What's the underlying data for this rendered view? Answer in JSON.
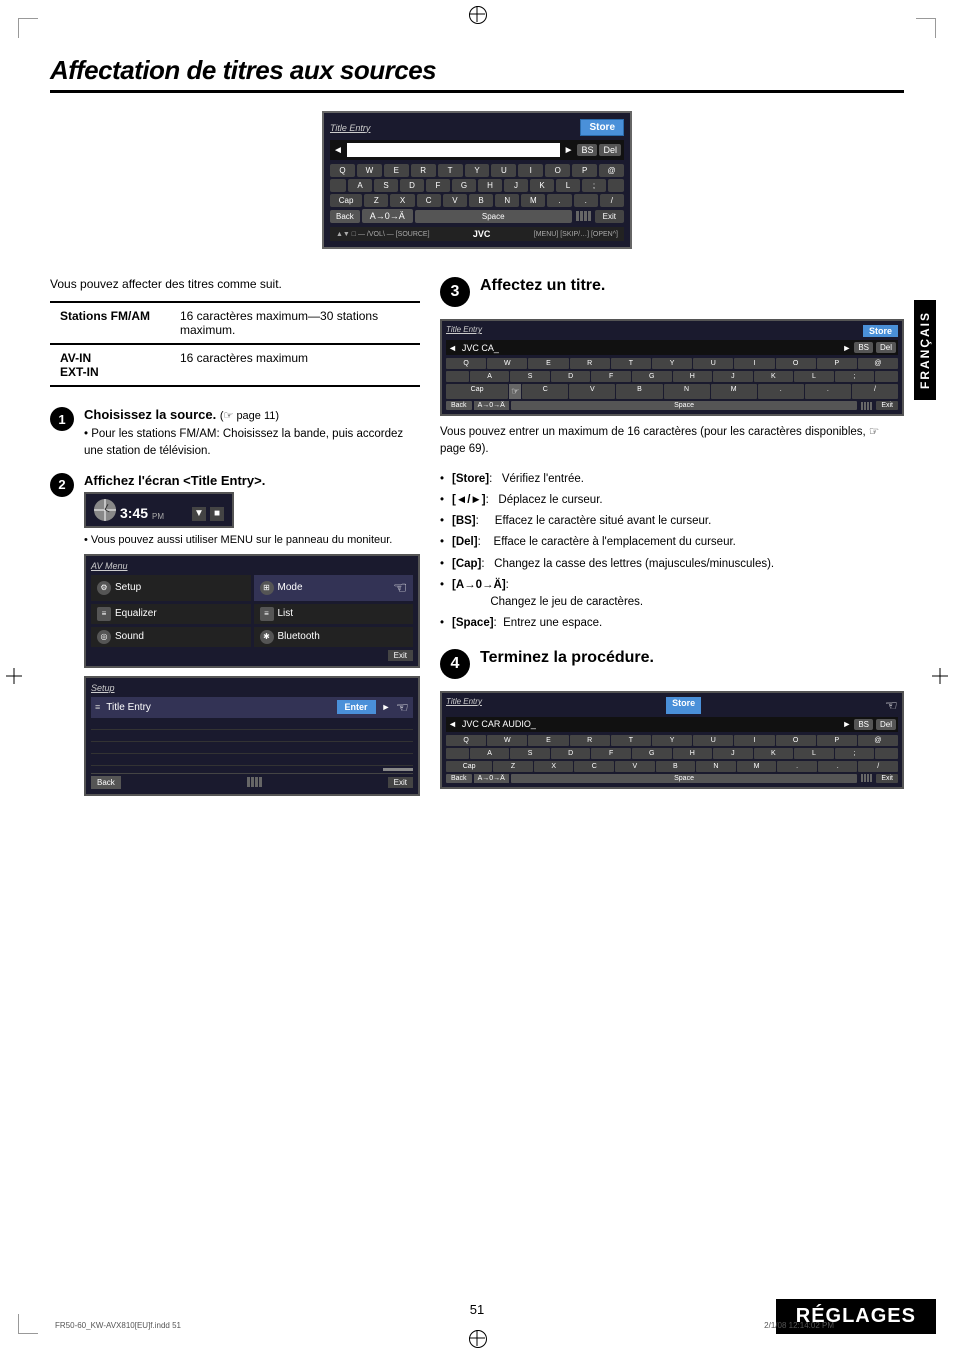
{
  "page": {
    "title": "Affectation de titres aux sources",
    "number": "51",
    "section": "RÉGLAGES",
    "language_tag": "FRANÇAIS",
    "file_info": "FR50-60_KW-AVX810[EU]f.indd   51",
    "date_info": "2/1/08   12:14:02 PM"
  },
  "intro_text": "Vous pouvez affecter des titres comme suit.",
  "table": {
    "rows": [
      {
        "header": "Stations FM/AM",
        "value": "16 caractères maximum—30 stations maximum."
      },
      {
        "header": "AV-IN\nEXT-IN",
        "value": "16 caractères maximum"
      }
    ]
  },
  "steps": [
    {
      "num": "1",
      "title": "Choisissez la source.",
      "ref": "(☞ page 11)",
      "body": "• Pour les stations FM/AM: Choisissez la bande, puis accordez une station de télévision."
    },
    {
      "num": "2",
      "title": "Affichez l'écran <Title Entry>.",
      "note": "• Vous pouvez aussi utiliser MENU sur le panneau du moniteur."
    },
    {
      "num": "3",
      "title": "Affectez un titre.",
      "body_text": "Vous pouvez entrer un maximum de 16 caractères (pour les caractères disponibles, ☞ page 69)."
    },
    {
      "num": "4",
      "title": "Terminez la procédure."
    }
  ],
  "bullet_items": [
    {
      "key": "[Store]",
      "desc": "Vérifiez l'entrée."
    },
    {
      "key": "[◄/►]",
      "desc": "Déplacez le curseur."
    },
    {
      "key": "[BS]",
      "desc": "Effacez le caractère situé avant le curseur."
    },
    {
      "key": "[Del]",
      "desc": "Efface le caractère à l'emplacement du curseur."
    },
    {
      "key": "[Cap]",
      "desc": "Changez la casse des lettres (majuscules/minuscules)."
    },
    {
      "key": "[A→0→Ä]",
      "desc": "Changez le jeu de caractères."
    },
    {
      "key": "[Space]",
      "desc": "Entrez une espace."
    }
  ],
  "title_entry_ui": {
    "title_label": "Title Entry",
    "store_label": "Store",
    "bs_label": "BS",
    "del_label": "Del",
    "back_label": "Back",
    "space_label": "Space",
    "exit_label": "Exit",
    "charset_label": "A→0→Ä",
    "keyboard_rows": [
      [
        "Q",
        "W",
        "E",
        "R",
        "T",
        "Y",
        "U",
        "I",
        "O",
        "P",
        "@"
      ],
      [
        "A",
        "S",
        "D",
        "F",
        "G",
        "H",
        "J",
        "K",
        "L",
        ";"
      ],
      [
        "Cap",
        "Z",
        "X",
        "C",
        "V",
        "B",
        "N",
        "M",
        ".",
        ".",
        "/"
      ]
    ]
  },
  "av_menu": {
    "title": "AV Menu",
    "items": [
      {
        "label": "Setup",
        "icon": "⚙"
      },
      {
        "label": "Mode",
        "icon": "⊞"
      },
      {
        "label": "Equalizer",
        "icon": "≡"
      },
      {
        "label": "List",
        "icon": "≡"
      },
      {
        "label": "Sound",
        "icon": "◎"
      },
      {
        "label": "Bluetooth",
        "icon": "✱"
      }
    ],
    "exit_label": "Exit"
  },
  "setup_menu": {
    "title": "Setup",
    "row_label": "Title Entry",
    "enter_label": "Enter",
    "back_label": "Back",
    "exit_label": "Exit"
  },
  "clock": {
    "time": "3:45",
    "ampm": "PM"
  }
}
